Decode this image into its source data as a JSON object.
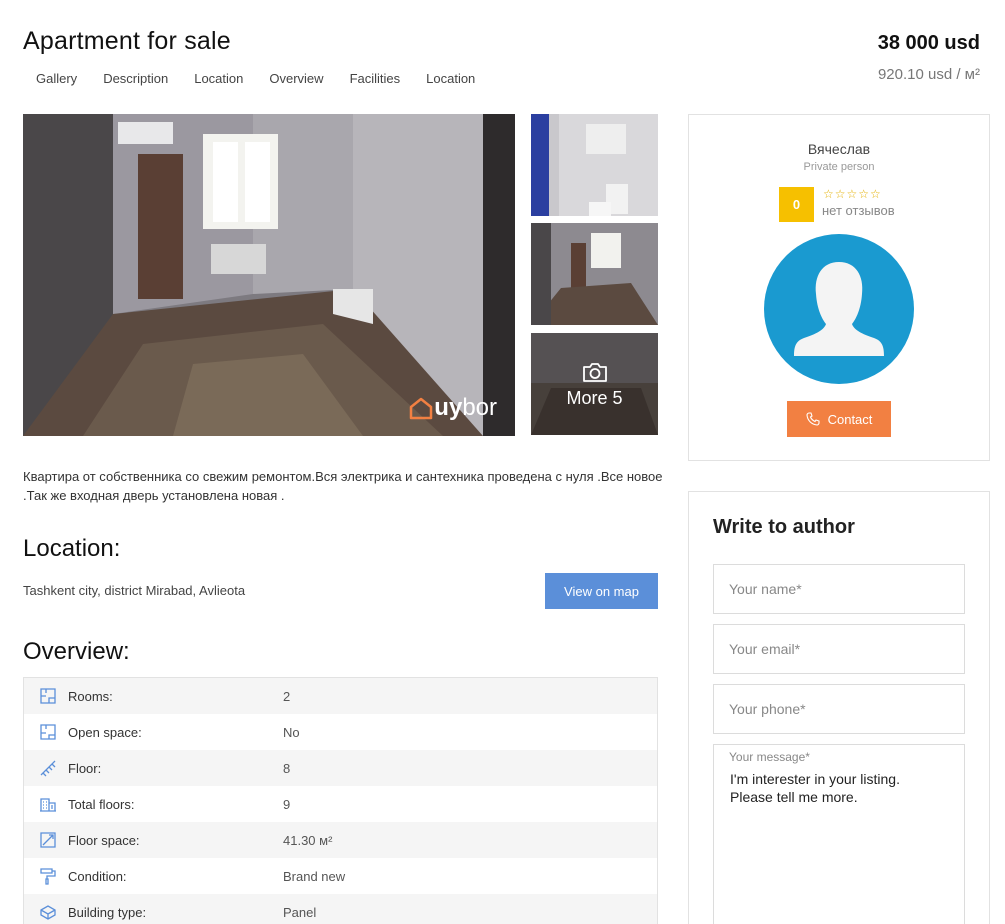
{
  "listing": {
    "title": "Apartment for sale",
    "price": "38 000 usd",
    "price_per_sqm": "920.10 usd / м²"
  },
  "tabs": [
    "Gallery",
    "Description",
    "Location",
    "Overview",
    "Facilities",
    "Location"
  ],
  "gallery": {
    "logo_prefix": "uy",
    "logo_suffix": "bor",
    "more_label": "More 5"
  },
  "description": "Квартира от собственника со свежим ремонтом.Вся электрика и сантехника проведена с нуля .Все новое .Так же входная дверь установлена новая .",
  "location": {
    "heading": "Location:",
    "address": "Tashkent city, district Mirabad, Avlieota",
    "map_button": "View on map"
  },
  "overview": {
    "heading": "Overview:",
    "rows": [
      {
        "icon": "floor-plan-icon",
        "label": "Rooms:",
        "value": "2"
      },
      {
        "icon": "open-space-icon",
        "label": "Open space:",
        "value": "No"
      },
      {
        "icon": "stairs-icon",
        "label": "Floor:",
        "value": "8"
      },
      {
        "icon": "building-icon",
        "label": "Total floors:",
        "value": "9"
      },
      {
        "icon": "area-icon",
        "label": "Floor space:",
        "value": "41.30 м²"
      },
      {
        "icon": "paint-roller-icon",
        "label": "Condition:",
        "value": "Brand new"
      },
      {
        "icon": "brick-icon",
        "label": "Building type:",
        "value": "Panel"
      }
    ]
  },
  "author": {
    "name": "Вячеслав",
    "type": "Private person",
    "rating": "0",
    "reviews": "нет отзывов",
    "contact_button": "Contact",
    "accent_rating": "#f6c000",
    "accent_contact": "#f28042",
    "avatar_color": "#1a9ad0"
  },
  "write": {
    "title": "Write to author",
    "name_placeholder": "Your name*",
    "email_placeholder": "Your email*",
    "phone_placeholder": "Your phone*",
    "message_label": "Your message*",
    "message_value": "I'm interester in your listing.\nPlease tell me more."
  }
}
